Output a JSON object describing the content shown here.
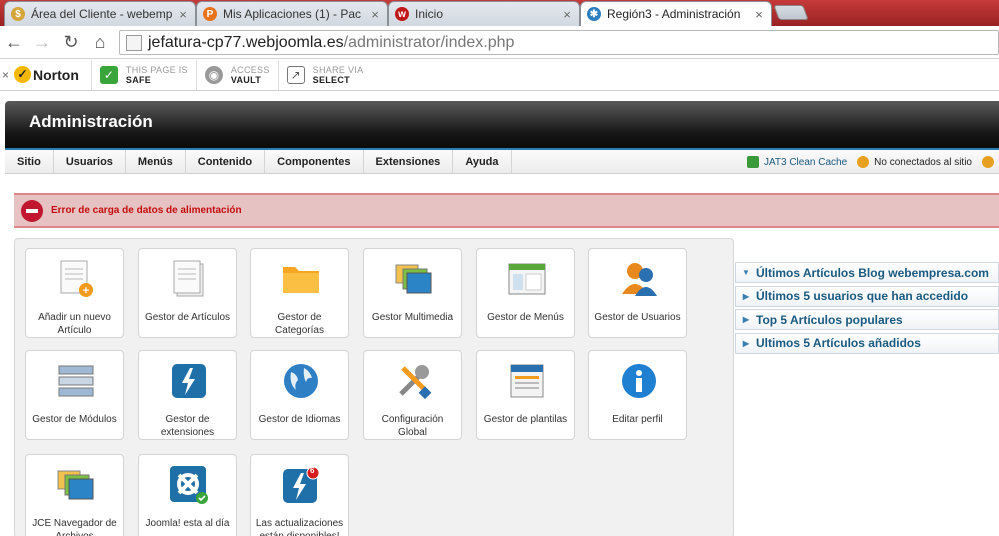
{
  "browser": {
    "tabs": [
      {
        "title": "Área del Cliente - webemp",
        "active": false,
        "favicon_color": "#d4a63a"
      },
      {
        "title": "Mis Aplicaciones (1) - Pac",
        "active": false,
        "favicon_color": "#e8731a"
      },
      {
        "title": "Inicio",
        "active": false,
        "favicon_color": "#c01818"
      },
      {
        "title": "Región3 - Administración",
        "active": true,
        "favicon_color": "#2e7fbf"
      }
    ],
    "url_host": "jefatura-cp77.webjoomla.es",
    "url_path": "/administrator/index.php"
  },
  "norton": {
    "logo_label": "Norton",
    "items": [
      {
        "line1": "THIS PAGE IS",
        "line2": "SAFE",
        "icon": "check-shield-icon",
        "color": "#3aa53a"
      },
      {
        "line1": "ACCESS",
        "line2": "VAULT",
        "icon": "vault-icon",
        "color": "#888888"
      },
      {
        "line1": "SHARE VIA",
        "line2": "SELECT",
        "icon": "share-icon",
        "color": "#666666"
      }
    ]
  },
  "admin": {
    "title": "Administración"
  },
  "menu": {
    "items": [
      "Sitio",
      "Usuarios",
      "Menús",
      "Contenido",
      "Componentes",
      "Extensiones",
      "Ayuda"
    ],
    "right": [
      {
        "label": "JAT3 Clean Cache",
        "icon": "cache-icon"
      },
      {
        "label": "No conectados al sitio",
        "icon": "users-icon"
      }
    ]
  },
  "error": {
    "message": "Error de carga de datos de alimentación"
  },
  "icons": [
    {
      "label": "Añadir un nuevo Artículo",
      "icon": "add-article-icon"
    },
    {
      "label": "Gestor de Artículos",
      "icon": "article-manager-icon"
    },
    {
      "label": "Gestor de Categorías",
      "icon": "folder-icon"
    },
    {
      "label": "Gestor Multimedia",
      "icon": "media-icon"
    },
    {
      "label": "Gestor de Menús",
      "icon": "menu-manager-icon"
    },
    {
      "label": "Gestor de Usuarios",
      "icon": "users-icon"
    },
    {
      "label": "Gestor de Módulos",
      "icon": "modules-icon"
    },
    {
      "label": "Gestor de extensiones",
      "icon": "extensions-icon"
    },
    {
      "label": "Gestor de Idiomas",
      "icon": "globe-icon"
    },
    {
      "label": "Configuración Global",
      "icon": "tools-icon"
    },
    {
      "label": "Gestor de plantilas",
      "icon": "template-icon"
    },
    {
      "label": "Editar perfil",
      "icon": "info-icon"
    },
    {
      "label": "JCE Navegador de Archivos",
      "icon": "jce-browser-icon"
    },
    {
      "label": "Joomla! esta al día",
      "icon": "joomla-icon"
    },
    {
      "label": "Las actualizaciones están disponibles!",
      "icon": "updates-icon",
      "badge": "6"
    }
  ],
  "sliders": [
    "Últimos Artículos Blog webempresa.com",
    "Últimos 5 usuarios que han accedido",
    "Top 5 Artículos populares",
    "Ultimos 5 Artículos añadidos"
  ]
}
